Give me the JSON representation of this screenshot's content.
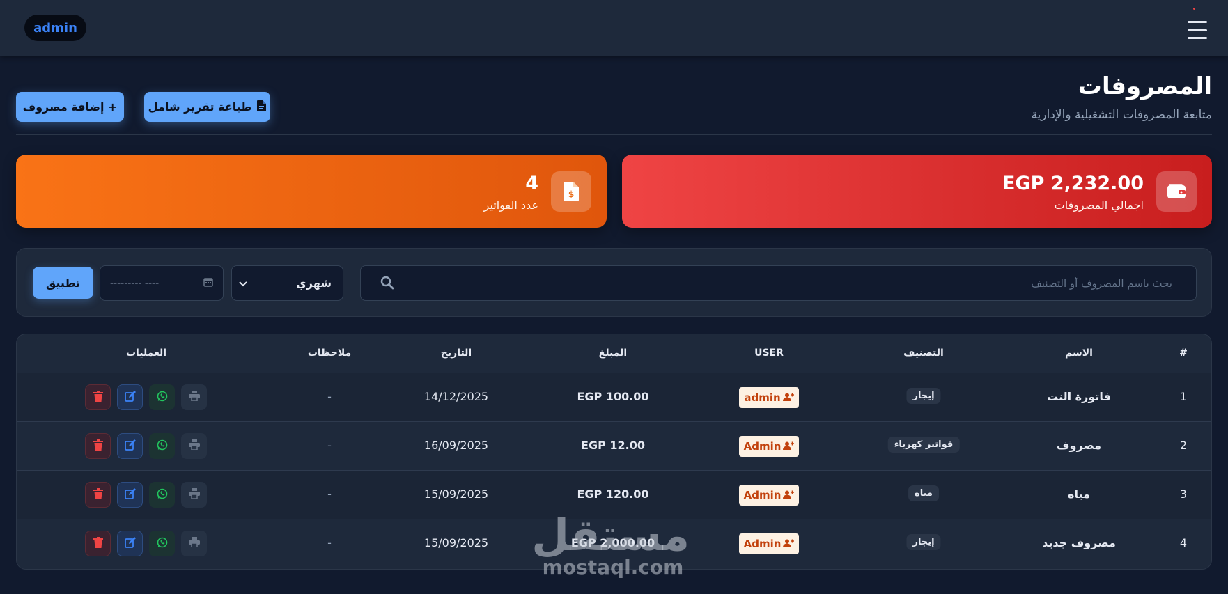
{
  "header": {
    "user_label": "admin"
  },
  "page": {
    "title": "المصروفات",
    "subtitle": "متابعة المصروفات التشغيلية والإدارية",
    "add_button": "+ إضافة مصروف",
    "print_button": "طباعة تقرير شامل"
  },
  "stats": {
    "total_value": "EGP 2,232.00",
    "total_label": "اجمالي المصروفات",
    "count_value": "4",
    "count_label": "عدد الفواتير"
  },
  "filters": {
    "search_placeholder": "بحث باسم المصروف أو التصنيف",
    "period_selected": "شهري",
    "date_value": "--------- ----",
    "apply_button": "تطبيق"
  },
  "table": {
    "columns": {
      "index": "#",
      "name": "الاسم",
      "category": "التصنيف",
      "user": "USER",
      "amount": "المبلغ",
      "date": "التاريخ",
      "notes": "ملاحظات",
      "actions": "العمليات"
    },
    "rows": [
      {
        "index": "1",
        "name": "فاتورة النت",
        "category": "إيجار",
        "user": "admin",
        "amount": "EGP 100.00",
        "date": "14/12/2025",
        "notes": "-"
      },
      {
        "index": "2",
        "name": "مصروف",
        "category": "فواتير كهرباء",
        "user": "Admin",
        "amount": "EGP 12.00",
        "date": "16/09/2025",
        "notes": "-"
      },
      {
        "index": "3",
        "name": "مياه",
        "category": "مياه",
        "user": "Admin",
        "amount": "EGP 120.00",
        "date": "15/09/2025",
        "notes": "-"
      },
      {
        "index": "4",
        "name": "مصروف جديد",
        "category": "إيجار",
        "user": "Admin",
        "amount": "EGP 2,000.00",
        "date": "15/09/2025",
        "notes": "-"
      }
    ]
  },
  "watermark": {
    "arabic": "مستقل",
    "latin": "mostaql.com"
  },
  "colors": {
    "accent_blue": "#60a5fa",
    "total_card": "#ef4444",
    "count_card": "#f97316",
    "background": "#111a2e",
    "panel": "#1e293b"
  }
}
